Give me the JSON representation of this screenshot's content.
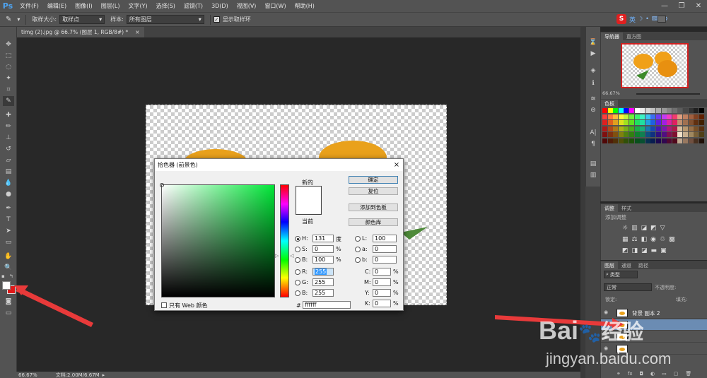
{
  "app": {
    "logo": "Ps",
    "menu": [
      "文件(F)",
      "编辑(E)",
      "图像(I)",
      "图层(L)",
      "文字(Y)",
      "选择(S)",
      "滤镜(T)",
      "3D(D)",
      "视图(V)",
      "窗口(W)",
      "帮助(H)"
    ],
    "window_controls": {
      "min": "—",
      "restore": "❐",
      "close": "✕"
    }
  },
  "options_bar": {
    "sample_size_label": "取样大小:",
    "sample_size_value": "取样点",
    "sample_label": "样本:",
    "sample_value": "所有图层",
    "show_ring_label": "显示取样环",
    "show_ring_checked": true
  },
  "document_tab": {
    "title": "timg (2).jpg @ 66.7% (图层 1, RGB/8#) *",
    "close": "×"
  },
  "status_bar": {
    "zoom": "66.67%",
    "doc_info": "文档:2.00M/6.67M"
  },
  "ime": {
    "label": "英"
  },
  "navigator_panel": {
    "tabs": [
      "导航器",
      "直方图"
    ],
    "zoom": "66.67%"
  },
  "swatches_panel": {
    "tab": "色板",
    "rows": [
      [
        "#ff0000",
        "#ffff00",
        "#00ff00",
        "#00ffff",
        "#0000ff",
        "#ff00ff",
        "#ffffff",
        "#ebebeb",
        "#d6d6d6",
        "#c2c2c2",
        "#adadad",
        "#999999",
        "#858585",
        "#707070",
        "#5c5c5c",
        "#474747",
        "#333333",
        "#1f1f1f",
        "#000000"
      ],
      [
        "#ff3b3b",
        "#ff7a3b",
        "#ffbb3b",
        "#fff33b",
        "#c3f33b",
        "#6ef33b",
        "#3bf36e",
        "#3bf3c3",
        "#3bc3f3",
        "#3b6ef3",
        "#6e3bf3",
        "#c33bf3",
        "#f33bc3",
        "#f33b6e",
        "#e0a080",
        "#c08060",
        "#a06040",
        "#804020",
        "#602000"
      ],
      [
        "#e02020",
        "#e06020",
        "#e0a020",
        "#e0e020",
        "#a0e020",
        "#60e020",
        "#20e060",
        "#20e0a0",
        "#20a0e0",
        "#2060e0",
        "#6020e0",
        "#a020e0",
        "#e020a0",
        "#e02060",
        "#c09070",
        "#a07050",
        "#805030",
        "#603010",
        "#402000"
      ],
      [
        "#b01818",
        "#b04818",
        "#b07818",
        "#b0b018",
        "#78b018",
        "#48b018",
        "#18b048",
        "#18b078",
        "#1878b0",
        "#1848b0",
        "#4818b0",
        "#7818b0",
        "#b01878",
        "#b01848",
        "#d8c0a0",
        "#b89870",
        "#987048",
        "#785028",
        "#583010"
      ],
      [
        "#801010",
        "#803010",
        "#805010",
        "#808010",
        "#508010",
        "#308010",
        "#108030",
        "#108050",
        "#105080",
        "#103080",
        "#301080",
        "#501080",
        "#801050",
        "#801030",
        "#f0e0c8",
        "#c8b090",
        "#a08860",
        "#786038",
        "#504018"
      ],
      [
        "#500808",
        "#501c08",
        "#503008",
        "#505008",
        "#305008",
        "#1c5008",
        "#08501c",
        "#085030",
        "#083050",
        "#081c50",
        "#1c0850",
        "#300850",
        "#500830",
        "#50081c",
        "#c0a890",
        "#987860",
        "#705040",
        "#483020",
        "#201008"
      ]
    ]
  },
  "adjustments_panel": {
    "tabs": [
      "调整",
      "样式"
    ],
    "header": "添加调整"
  },
  "layers_panel": {
    "tabs": [
      "图层",
      "通道",
      "路径"
    ],
    "filter": "类型",
    "blend_mode": "正常",
    "opacity_label": "不透明度:",
    "lock_label": "锁定:",
    "fill_label": "填充:",
    "layers": [
      {
        "name": "背景 副本 2",
        "selected": false
      },
      {
        "name": "",
        "selected": true
      },
      {
        "name": "",
        "selected": false
      },
      {
        "name": "",
        "selected": false
      }
    ]
  },
  "color_picker": {
    "title": "拾色器 (前景色)",
    "close": "×",
    "new_label": "新的",
    "current_label": "当前",
    "new_color": "#ffffff",
    "current_color": "#ffffff",
    "ok": "确定",
    "reset": "复位",
    "add_swatch": "添加到色板",
    "color_libraries": "颜色库",
    "H_label": "H:",
    "H": "131",
    "H_unit": "度",
    "S_label": "S:",
    "S": "0",
    "S_unit": "%",
    "Bv_label": "B:",
    "Bv": "100",
    "Bv_unit": "%",
    "R_label": "R:",
    "R": "255",
    "G_label": "G:",
    "G": "255",
    "B_label": "B:",
    "B": "255",
    "L_label": "L:",
    "L": "100",
    "a_label": "a:",
    "a": "0",
    "b_label": "b:",
    "b": "0",
    "C_label": "C:",
    "C": "0",
    "M_label": "M:",
    "M": "0",
    "Y_label": "Y:",
    "Y": "0",
    "K_label": "K:",
    "K": "0",
    "cmyk_unit": "%",
    "hex_label": "#",
    "hex": "ffffff",
    "web_only_label": "只有 Web 颜色",
    "hue_deg": 131
  },
  "watermark": {
    "brand": "Bai",
    "brand2": "经验",
    "url": "jingyan.baidu.com"
  }
}
